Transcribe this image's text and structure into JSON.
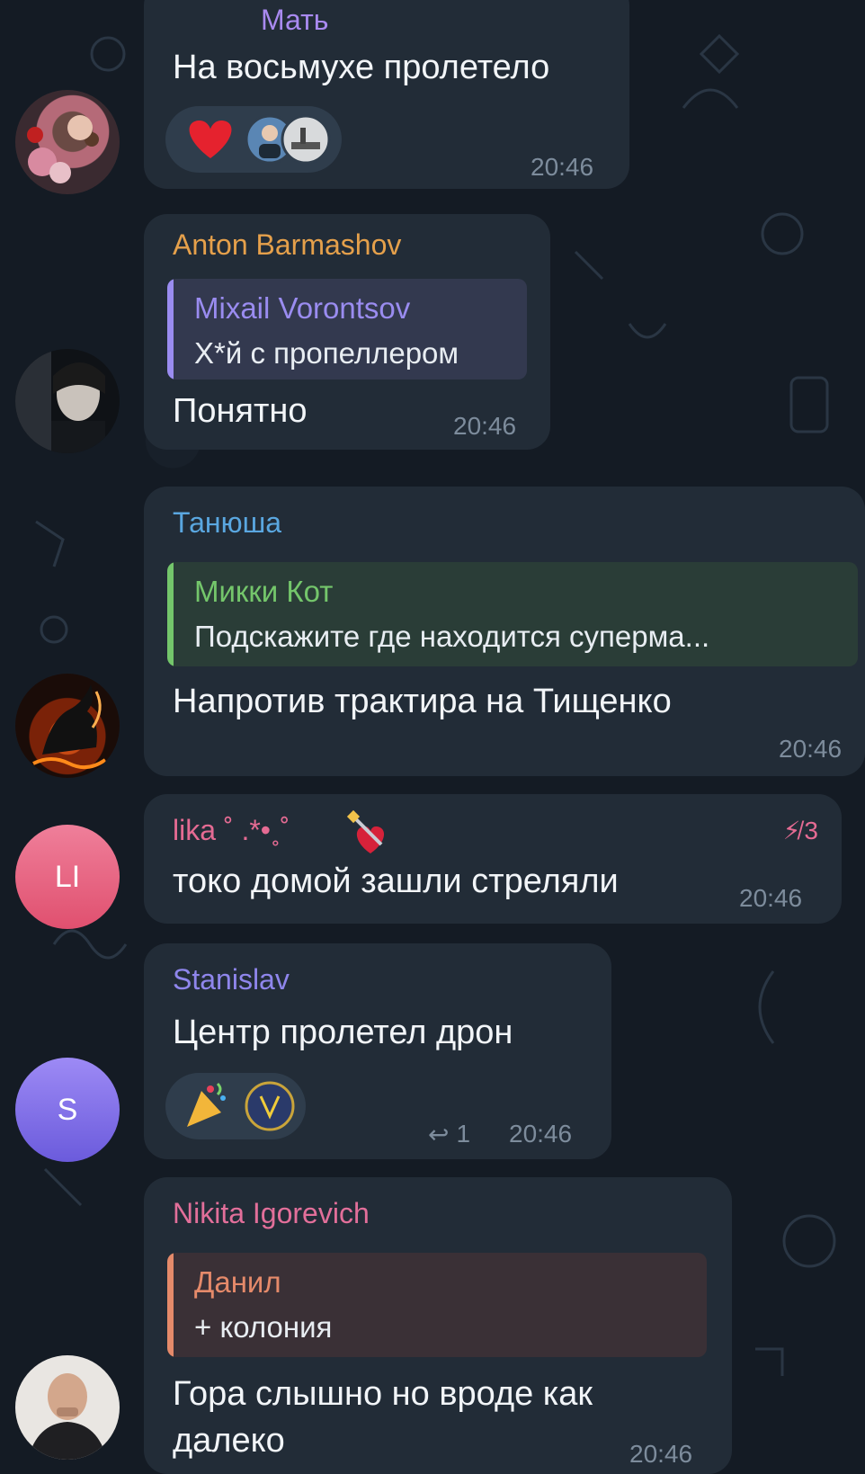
{
  "messages": [
    {
      "sender": "Мать",
      "text": "На восьмухе пролетело",
      "time": "20:46",
      "reactions": [
        "heart-emoji",
        "user-avatar-1",
        "user-avatar-2"
      ]
    },
    {
      "sender": "Anton Barmashov",
      "sender_color": "#e5a04b",
      "reply": {
        "name": "Mixail Vorontsov",
        "text": "Х*й с пропеллером",
        "color": "#9a8cf0"
      },
      "text": "Понятно",
      "time": "20:46"
    },
    {
      "sender": "Танюша",
      "sender_color": "#5aa7e0",
      "reply": {
        "name": "Микки Кот",
        "text": "Подскажите где находится суперма...",
        "color": "#74c66b"
      },
      "text": "Напротив трактира на Тищенко",
      "time": "20:46"
    },
    {
      "sender": "lika ˚ .*•˳˚",
      "sender_color": "#e56b93",
      "avatar_initials": "LI",
      "boost_count": "3",
      "text": "токо домой зашли стреляли",
      "time": "20:46"
    },
    {
      "sender": "Stanislav",
      "sender_color": "#8f86ec",
      "avatar_initials": "S",
      "reactions": [
        "party-popper-emoji",
        "ukraine-emblem-emoji"
      ],
      "reply_count": "1",
      "text": "Центр пролетел дрон",
      "time": "20:46"
    },
    {
      "sender": "Nikita Igorevich",
      "sender_color": "#e26f9a",
      "reply": {
        "name": "Данил",
        "text": "+ колония",
        "color": "#e58a6a"
      },
      "text_line1": "Гора слышно но вроде как",
      "text_line2": "далеко",
      "time": "20:46"
    }
  ]
}
